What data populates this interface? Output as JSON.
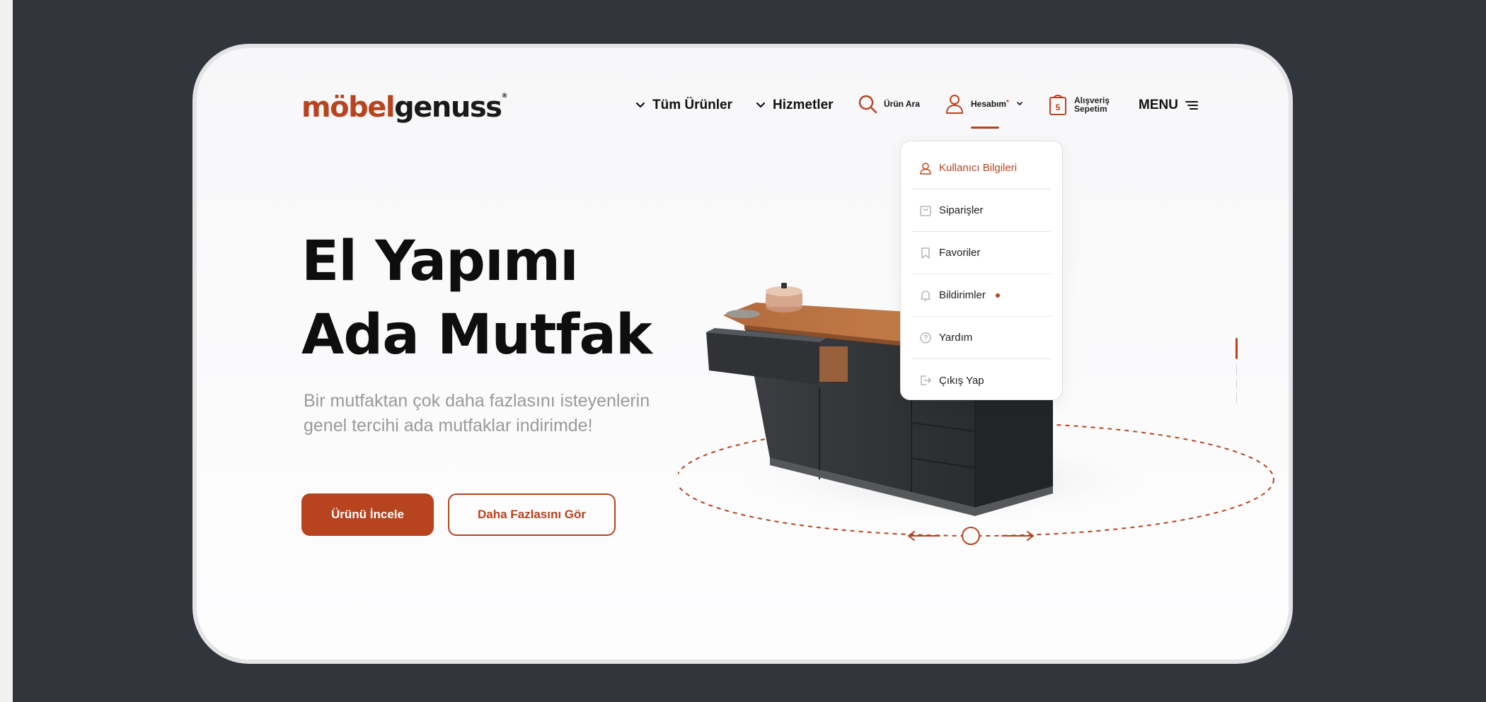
{
  "brand": {
    "part1": "möbel",
    "part2": "genuss",
    "reg": "®"
  },
  "nav": {
    "all_products": "Tüm Ürünler",
    "services": "Hizmetler",
    "search_label": "Ürün Ara",
    "account_label": "Hesabım",
    "account_sup": "*",
    "cart_line1": "Alışveriş",
    "cart_line2": "Sepetim",
    "cart_count": "5",
    "menu_label": "MENU"
  },
  "hero": {
    "title_line1": "El Yapımı",
    "title_line2": "Ada Mutfak",
    "subtitle_line1": "Bir mutfaktan çok daha fazlasını isteyenlerin",
    "subtitle_line2": "genel tercihi ada mutfaklar indirimde!",
    "primary_button": "Ürünü İncele",
    "secondary_button": "Daha Fazlasını Gör"
  },
  "account_menu": {
    "items": [
      {
        "label": "Kullanıcı Bilgileri",
        "icon": "user-icon",
        "active": true
      },
      {
        "label": "Siparişler",
        "icon": "bag-icon",
        "active": false
      },
      {
        "label": "Favoriler",
        "icon": "bookmark-icon",
        "active": false
      },
      {
        "label": "Bildirimler",
        "icon": "bell-icon",
        "active": false,
        "badge": true
      },
      {
        "label": "Yardım",
        "icon": "help-icon",
        "active": false
      },
      {
        "label": "Çıkış Yap",
        "icon": "logout-icon",
        "active": false
      }
    ]
  },
  "colors": {
    "accent": "#b8431f",
    "backdrop": "#32353c",
    "frame": "#fafafb",
    "text_dark": "#0e0e0e",
    "text_muted": "#9a9a9e"
  }
}
